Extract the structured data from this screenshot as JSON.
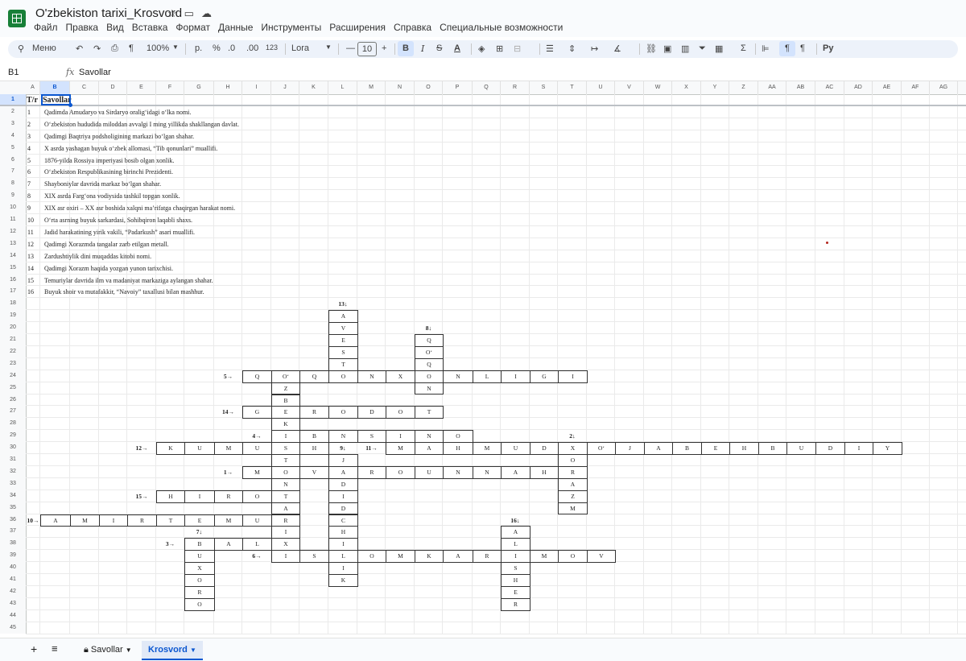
{
  "app": {
    "title": "O'zbekiston tarixi_Krosvord",
    "menu": [
      "Файл",
      "Правка",
      "Вид",
      "Вставка",
      "Формат",
      "Данные",
      "Инструменты",
      "Расширения",
      "Справка",
      "Специальные возможности"
    ]
  },
  "toolbar": {
    "menu_search": "Меню",
    "zoom": "100%",
    "currency": "р.",
    "percent": "%",
    "dec_dec": ".0",
    "dec_inc": ".00",
    "num_format": "123",
    "font": "Lora",
    "font_size": "10",
    "bold": "B",
    "italic": "I",
    "strike": "S",
    "text_color": "A"
  },
  "formula_bar": {
    "cell": "B1",
    "fx": "fx",
    "value": "Savollar"
  },
  "columns": [
    "A",
    "B",
    "C",
    "D",
    "E",
    "F",
    "G",
    "H",
    "I",
    "J",
    "K",
    "L",
    "M",
    "N",
    "O",
    "P",
    "Q",
    "R",
    "S",
    "T",
    "U",
    "V",
    "W",
    "X",
    "Y",
    "Z",
    "AA",
    "AB",
    "AC",
    "AD",
    "AE",
    "AF",
    "AG"
  ],
  "rows": [
    "1",
    "2",
    "3",
    "4",
    "5",
    "6",
    "7",
    "8",
    "9",
    "10",
    "11",
    "12",
    "13",
    "14",
    "15",
    "16",
    "17",
    "18",
    "19",
    "20",
    "21",
    "22",
    "23",
    "24",
    "25",
    "26",
    "27",
    "28",
    "29",
    "30",
    "31",
    "32",
    "33",
    "34",
    "35",
    "36",
    "37",
    "38",
    "39",
    "40",
    "41",
    "42",
    "43",
    "44",
    "45"
  ],
  "sheet": {
    "header_a": "T/r",
    "header_b": "Savollar",
    "questions": [
      {
        "n": "1",
        "q": "Qadimda Amudaryo va Sirdaryo oralig‘idagi o‘lka nomi."
      },
      {
        "n": "2",
        "q": "O‘zbekiston hududida miloddan avvalgi I ming yillikda shakllangan davlat."
      },
      {
        "n": "3",
        "q": "Qadimgi Baqtriya podsholigining markazi bo‘lgan shahar."
      },
      {
        "n": "4",
        "q": "X asrda yashagan buyuk o‘zbek allomasi, “Tib qonunlari” muallifi."
      },
      {
        "n": "5",
        "q": "1876-yilda Rossiya imperiyasi bosib olgan xonlik."
      },
      {
        "n": "6",
        "q": "O‘zbekiston Respublikasining birinchi Prezidenti."
      },
      {
        "n": "7",
        "q": "Shayboniylar davrida markaz bo‘lgan shahar."
      },
      {
        "n": "8",
        "q": "XIX asrda Farg‘ona vodiysida tashkil topgan xonlik."
      },
      {
        "n": "9",
        "q": "XIX asr oxiri – XX asr boshida xalqni ma’rifatga chaqirgan harakat nomi."
      },
      {
        "n": "10",
        "q": "O‘rta asrning buyuk sarkardasi, Sohibqiron laqabli shaxs."
      },
      {
        "n": "11",
        "q": "Jadid harakatining yirik vakili, “Padarkush” asari muallifi."
      },
      {
        "n": "12",
        "q": "Qadimgi Xorazmda tangalar zarb etilgan metall."
      },
      {
        "n": "13",
        "q": "Zardushtiylik dini muqaddas kitobi nomi."
      },
      {
        "n": "14",
        "q": "Qadimgi Xorazm haqida yozgan yunon tarixchisi."
      },
      {
        "n": "15",
        "q": "Temuriylar davrida ilm va madaniyat markaziga aylangan shahar."
      },
      {
        "n": "16",
        "q": "Buyuk shoir va mutafakkir, “Navoiy” taxallusi bilan mashhur."
      }
    ],
    "crossword": [
      {
        "clue": "13↓",
        "row": 18,
        "col": "L"
      },
      {
        "clue": "8↓",
        "row": 20,
        "col": "O"
      },
      {
        "clue": "5→",
        "row": 24,
        "col": "H"
      },
      {
        "clue": "14→",
        "row": 27,
        "col": "H"
      },
      {
        "clue": "4→",
        "row": 29,
        "col": "I"
      },
      {
        "clue": "2↓",
        "row": 29,
        "col": "T"
      },
      {
        "clue": "12→",
        "row": 30,
        "col": "E"
      },
      {
        "clue": "9↓",
        "row": 30,
        "col": "L"
      },
      {
        "clue": "11→",
        "row": 30,
        "col": "M"
      },
      {
        "clue": "1→",
        "row": 32,
        "col": "H"
      },
      {
        "clue": "15→",
        "row": 34,
        "col": "E"
      },
      {
        "clue": "10→",
        "row": 36,
        "col": "A"
      },
      {
        "clue": "16↓",
        "row": 36,
        "col": "R"
      },
      {
        "clue": "7↓",
        "row": 37,
        "col": "G"
      },
      {
        "clue": "3→",
        "row": 38,
        "col": "F"
      },
      {
        "clue": "6→",
        "row": 39,
        "col": "I"
      }
    ],
    "letters": [
      [
        "L19",
        "A"
      ],
      [
        "L20",
        "V"
      ],
      [
        "L21",
        "E"
      ],
      [
        "L22",
        "S"
      ],
      [
        "L23",
        "T"
      ],
      [
        "O21",
        "Q"
      ],
      [
        "O22",
        "O‘"
      ],
      [
        "O23",
        "Q"
      ],
      [
        "O25",
        "N"
      ],
      [
        "I24",
        "Q"
      ],
      [
        "J24",
        "O‘"
      ],
      [
        "K24",
        "Q"
      ],
      [
        "L24",
        "O"
      ],
      [
        "M24",
        "N"
      ],
      [
        "N24",
        "X"
      ],
      [
        "O24",
        "O"
      ],
      [
        "P24",
        "N"
      ],
      [
        "Q24",
        "L"
      ],
      [
        "R24",
        "I"
      ],
      [
        "S24",
        "G"
      ],
      [
        "T24",
        "I"
      ],
      [
        "J25",
        "Z"
      ],
      [
        "J26",
        "B"
      ],
      [
        "I27",
        "G"
      ],
      [
        "J27",
        "E"
      ],
      [
        "K27",
        "R"
      ],
      [
        "L27",
        "O"
      ],
      [
        "M27",
        "D"
      ],
      [
        "N27",
        "O"
      ],
      [
        "O27",
        "T"
      ],
      [
        "J28",
        "K"
      ],
      [
        "J29",
        "I"
      ],
      [
        "K29",
        "B"
      ],
      [
        "L29",
        "N"
      ],
      [
        "M29",
        "S"
      ],
      [
        "N29",
        "I"
      ],
      [
        "O29",
        "N"
      ],
      [
        "P29",
        "O"
      ],
      [
        "F30",
        "K"
      ],
      [
        "G30",
        "U"
      ],
      [
        "H30",
        "M"
      ],
      [
        "I30",
        "U"
      ],
      [
        "J30",
        "S"
      ],
      [
        "K30",
        "H"
      ],
      [
        "N30",
        "M"
      ],
      [
        "O30",
        "A"
      ],
      [
        "P30",
        "H"
      ],
      [
        "Q30",
        "M"
      ],
      [
        "R30",
        "U"
      ],
      [
        "S30",
        "D"
      ],
      [
        "T30",
        "X"
      ],
      [
        "U30",
        "O‘"
      ],
      [
        "V30",
        "J"
      ],
      [
        "W30",
        "A"
      ],
      [
        "X30",
        "B"
      ],
      [
        "Y30",
        "E"
      ],
      [
        "Z30",
        "H"
      ],
      [
        "AA30",
        "B"
      ],
      [
        "AB30",
        "U"
      ],
      [
        "AC30",
        "D"
      ],
      [
        "AD30",
        "I"
      ],
      [
        "AE30",
        "Y"
      ],
      [
        "J31",
        "T"
      ],
      [
        "L31",
        "J"
      ],
      [
        "T31",
        "O"
      ],
      [
        "I32",
        "M"
      ],
      [
        "J32",
        "O"
      ],
      [
        "K32",
        "V"
      ],
      [
        "L32",
        "A"
      ],
      [
        "M32",
        "R"
      ],
      [
        "N32",
        "O"
      ],
      [
        "O32",
        "U"
      ],
      [
        "P32",
        "N"
      ],
      [
        "Q32",
        "N"
      ],
      [
        "R32",
        "A"
      ],
      [
        "S32",
        "H"
      ],
      [
        "T32",
        "R"
      ],
      [
        "J33",
        "N"
      ],
      [
        "L33",
        "D"
      ],
      [
        "T33",
        "A"
      ],
      [
        "F34",
        "H"
      ],
      [
        "G34",
        "I"
      ],
      [
        "H34",
        "R"
      ],
      [
        "I34",
        "O"
      ],
      [
        "J34",
        "T"
      ],
      [
        "L34",
        "I"
      ],
      [
        "T34",
        "Z"
      ],
      [
        "J35",
        "A"
      ],
      [
        "L35",
        "D"
      ],
      [
        "T35",
        "M"
      ],
      [
        "B36",
        "A"
      ],
      [
        "C36",
        "M"
      ],
      [
        "D36",
        "I"
      ],
      [
        "E36",
        "R"
      ],
      [
        "F36",
        "T"
      ],
      [
        "G36",
        "E"
      ],
      [
        "H36",
        "M"
      ],
      [
        "I36",
        "U"
      ],
      [
        "J36",
        "R"
      ],
      [
        "L36",
        "C"
      ],
      [
        "J37",
        "I"
      ],
      [
        "L37",
        "H"
      ],
      [
        "R37",
        "A"
      ],
      [
        "G38",
        "B"
      ],
      [
        "H38",
        "A"
      ],
      [
        "I38",
        "L"
      ],
      [
        "J38",
        "X"
      ],
      [
        "L38",
        "I"
      ],
      [
        "R38",
        "L"
      ],
      [
        "G39",
        "U"
      ],
      [
        "J39",
        "I"
      ],
      [
        "K39",
        "S"
      ],
      [
        "L39",
        "L"
      ],
      [
        "M39",
        "O"
      ],
      [
        "N39",
        "M"
      ],
      [
        "O39",
        "K"
      ],
      [
        "P39",
        "A"
      ],
      [
        "Q39",
        "R"
      ],
      [
        "R39",
        "I"
      ],
      [
        "S39",
        "M"
      ],
      [
        "T39",
        "O"
      ],
      [
        "U39",
        "V"
      ],
      [
        "G40",
        "X"
      ],
      [
        "L40",
        "I"
      ],
      [
        "R40",
        "S"
      ],
      [
        "G41",
        "O"
      ],
      [
        "L41",
        "K"
      ],
      [
        "R41",
        "H"
      ],
      [
        "G42",
        "R"
      ],
      [
        "R42",
        "E"
      ],
      [
        "G43",
        "O"
      ],
      [
        "R43",
        "R"
      ]
    ]
  },
  "tabs": [
    {
      "label": "Savollar",
      "active": false
    },
    {
      "label": "Krosvord",
      "active": true
    }
  ],
  "colors": {
    "accent": "#0b57d0",
    "sheets_green": "#188038",
    "selection": "#d3e3fd"
  }
}
